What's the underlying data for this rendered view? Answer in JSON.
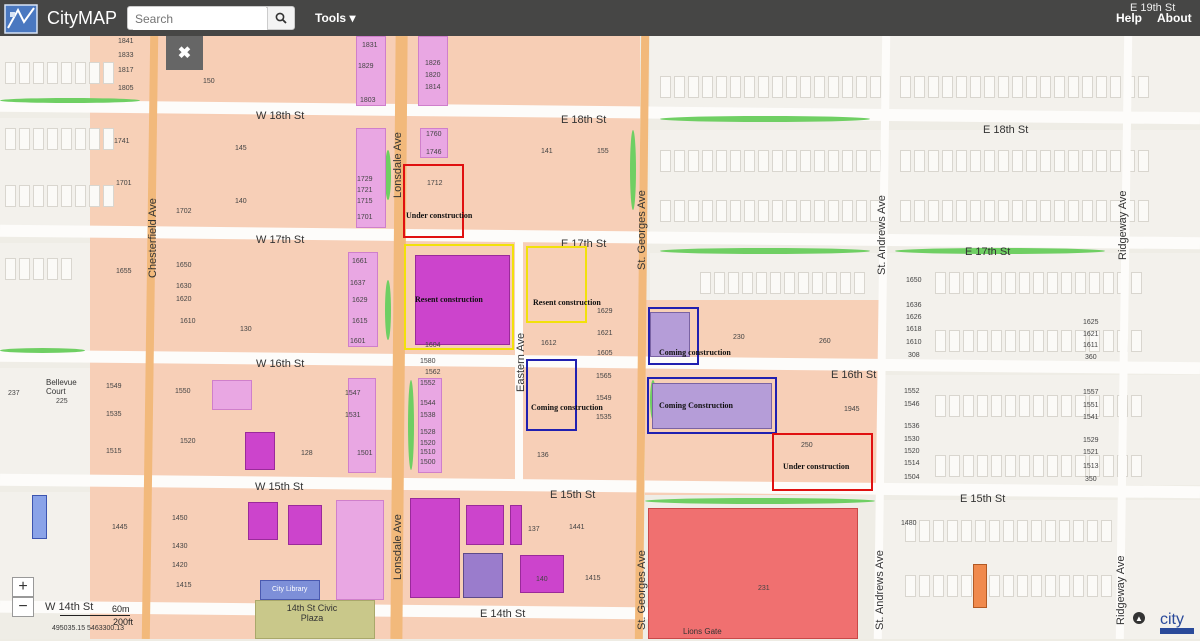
{
  "header": {
    "title": "CityMAP",
    "search_placeholder": "Search",
    "menu_tools": "Tools ▾",
    "menu_help": "Help",
    "menu_about": "About"
  },
  "controls": {
    "close_glyph": "✖",
    "zoom_in": "+",
    "zoom_out": "−",
    "scale_metric": "60m",
    "scale_imperial": "200ft",
    "coordinates": "495035.15 5463300.13"
  },
  "streets": {
    "w18": "W 18th St",
    "e18a": "E 18th St",
    "e18b": "E 18th St",
    "w17": "W 17th St",
    "e17a": "E 17th St",
    "e17b": "E 17th St",
    "w16": "W 16th St",
    "e16": "E 16th St",
    "w15": "W 15th St",
    "e15a": "E 15th St",
    "e15b": "E 15th St",
    "w14": "W 14th St",
    "e14": "E 14th St",
    "e19": "E 19th St",
    "chesterfield": "Chesterfield Ave",
    "lonsdale": "Lonsdale Ave",
    "eastern": "Eastern Ave",
    "stgeorges": "St. Georges Ave",
    "standrews": "St. Andrews Ave",
    "ridgeway": "Ridgeway Ave"
  },
  "places": {
    "bellevue": "Bellevue Court",
    "library": "City Library",
    "plaza": "14th St Civic Plaza",
    "hospital": "Lions Gate"
  },
  "annotations": {
    "under1": "Under construction",
    "under2": "Under construction",
    "resent1": "Resent construction",
    "resent2": "Resent construction",
    "coming1": "Coming construction",
    "coming2": "Coming construction",
    "coming3": "Coming Construction"
  },
  "addresses": {
    "a1": "1841",
    "a2": "1833",
    "a3": "1817",
    "a4": "1805",
    "a5": "1831",
    "a6": "1829",
    "a7": "1826",
    "a8": "1820",
    "a9": "1814",
    "a10": "1803",
    "a11": "1760",
    "a12": "1746",
    "a13": "1729",
    "a14": "1721",
    "a15": "1715",
    "a16": "1701",
    "a17": "1712",
    "a18": "1702",
    "a19": "1741",
    "a20": "1701",
    "a21": "1655",
    "a22": "1650",
    "a23": "1630",
    "a24": "1620",
    "a25": "1610",
    "a26": "1661",
    "a27": "1637",
    "a28": "1629",
    "a29": "1615",
    "a30": "1601",
    "a31": "1604",
    "a32": "1612",
    "a33": "1629",
    "a34": "1621",
    "a35": "1605",
    "a36": "1549",
    "a37": "1535",
    "a38": "1520",
    "a39": "1515",
    "a40": "1550",
    "a41": "1547",
    "a42": "1531",
    "a43": "1501",
    "a44": "1580",
    "a45": "1562",
    "a46": "1552",
    "a47": "1544",
    "a48": "1538",
    "a49": "1528",
    "a50": "1520",
    "a51": "1510",
    "a52": "1500",
    "a53": "1565",
    "a54": "1549",
    "a55": "1535",
    "a56": "1445",
    "a57": "1450",
    "a58": "1430",
    "a59": "1420",
    "a60": "1415",
    "a61": "1441",
    "a62": "1415",
    "a63": "1480",
    "a64": "1650",
    "a65": "1636",
    "a66": "1626",
    "a67": "1618",
    "a68": "1610",
    "a69": "308",
    "a70": "1625",
    "a71": "1621",
    "a72": "1611",
    "a73": "360",
    "a74": "1557",
    "a75": "1551",
    "a76": "1541",
    "a77": "1529",
    "a78": "1521",
    "a79": "1513",
    "a80": "350",
    "a81": "1552",
    "a82": "1546",
    "a83": "1536",
    "a84": "1530",
    "a85": "1520",
    "a86": "1514",
    "a87": "1504",
    "a88": "230",
    "a89": "260",
    "a90": "250",
    "a91": "1945",
    "a92": "231",
    "a93": "225",
    "a94": "237",
    "a95": "145",
    "a96": "140",
    "a97": "130",
    "a98": "150",
    "a99": "141",
    "a100": "155",
    "a101": "128",
    "a102": "136",
    "a103": "137",
    "a104": "140"
  }
}
